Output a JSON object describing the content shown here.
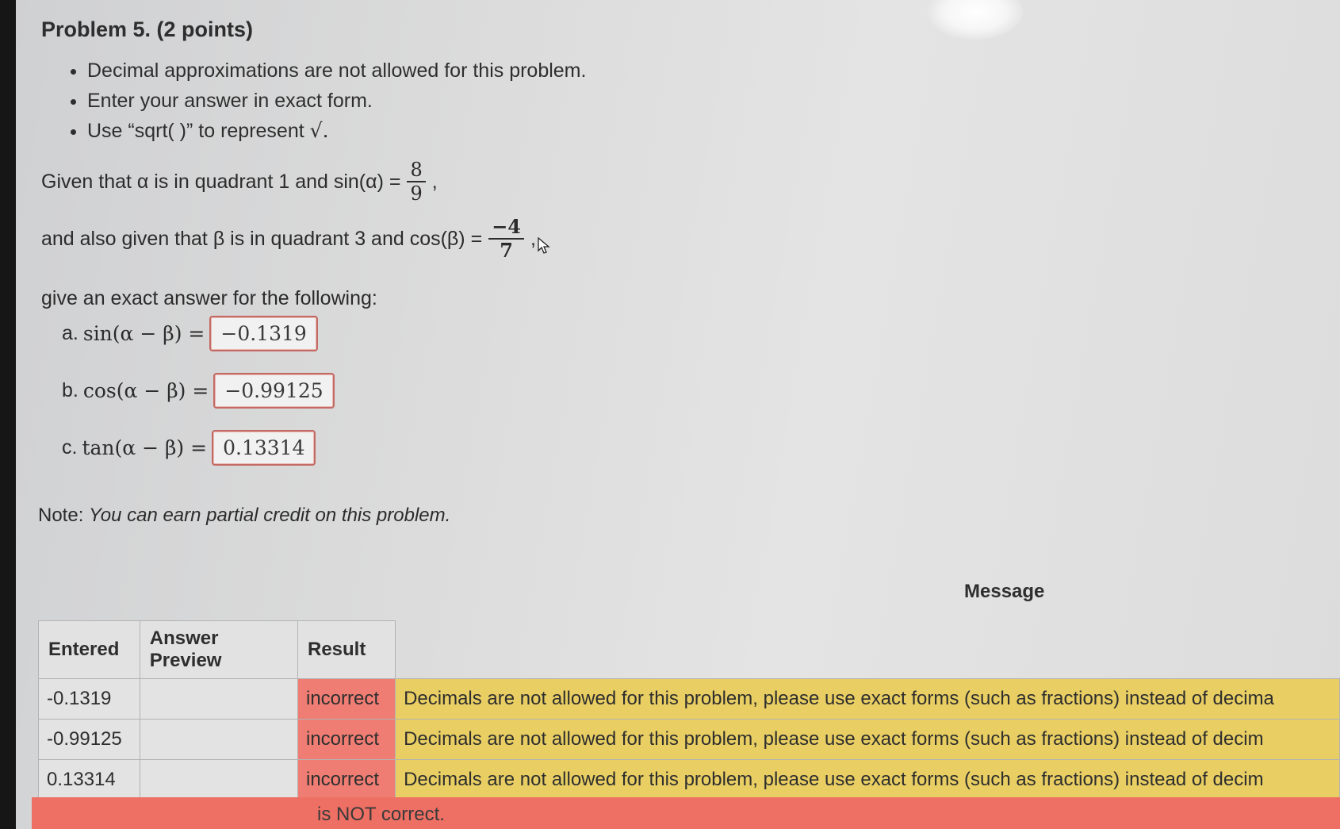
{
  "problem": {
    "title": "Problem 5. (2 points)",
    "instructions": [
      "Decimal approximations are not allowed for this problem.",
      "Enter your answer in exact form.",
      "Use “sqrt( )” to represent"
    ],
    "sqrt_symbol": "√.",
    "given_alpha_text": "Given that α is in quadrant 1 and sin(α) =",
    "alpha_num": "8",
    "alpha_den": "9",
    "given_beta_text": "and also given that β is in quadrant 3 and cos(β) =",
    "beta_num": "−4",
    "beta_den": "7",
    "comma": ",",
    "give_text": "give an exact answer for the following:",
    "questions": [
      {
        "label": "a.",
        "expr": "sin(α − β) =",
        "answer": "−0.1319"
      },
      {
        "label": "b.",
        "expr": "cos(α − β) =",
        "answer": "−0.99125"
      },
      {
        "label": "c.",
        "expr": "tan(α − β) =",
        "answer": "0.13314"
      }
    ],
    "note_label": "Note:",
    "note_text": "You can earn partial credit on this problem."
  },
  "results_table": {
    "headers": [
      "Entered",
      "Answer Preview",
      "Result",
      "Message"
    ],
    "rows": [
      {
        "entered": "-0.1319",
        "preview": "",
        "result": "incorrect",
        "message": "Decimals are not allowed for this problem, please use exact forms (such as fractions) instead of decima"
      },
      {
        "entered": "-0.99125",
        "preview": "",
        "result": "incorrect",
        "message": "Decimals are not allowed for this problem, please use exact forms (such as fractions) instead of decim"
      },
      {
        "entered": "0.13314",
        "preview": "",
        "result": "incorrect",
        "message": "Decimals are not allowed for this problem, please use exact forms (such as fractions) instead of decim"
      }
    ]
  },
  "footer": {
    "status_text": "is NOT correct."
  },
  "colors": {
    "incorrect": "#ef7d73",
    "message": "#e9cf63",
    "answer_border": "#c46a64"
  },
  "icons": {
    "cursor": "mouse-cursor-icon"
  }
}
